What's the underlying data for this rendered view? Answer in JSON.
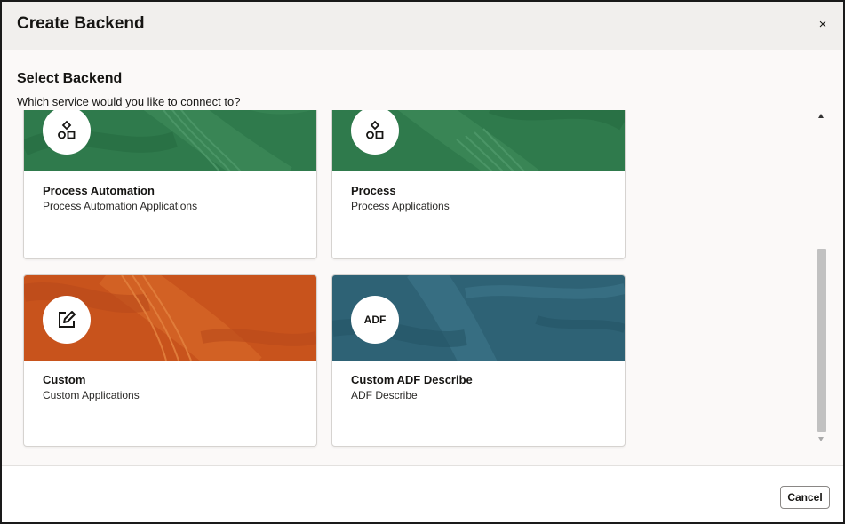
{
  "dialog": {
    "title": "Create Backend",
    "close_icon": "close-icon",
    "close_glyph": "×"
  },
  "section": {
    "title": "Select Backend",
    "subtitle": "Which service would you like to connect to?"
  },
  "cards": [
    {
      "title": "Process Automation",
      "description": "Process Automation Applications",
      "icon": "shapes-icon",
      "banner_color": "#2f7a4c"
    },
    {
      "title": "Process",
      "description": "Process Applications",
      "icon": "shapes-icon",
      "banner_color": "#2f7a4c"
    },
    {
      "title": "Custom",
      "description": "Custom Applications",
      "icon": "edit-icon",
      "banner_color": "#c8531c"
    },
    {
      "title": "Custom ADF Describe",
      "description": "ADF Describe",
      "icon": "adf-badge",
      "badge_text": "ADF",
      "banner_color": "#2e6275"
    }
  ],
  "footer": {
    "cancel_label": "Cancel"
  },
  "colors": {
    "header_bg": "#f1efed",
    "green_banner": "#2f7a4c",
    "orange_banner": "#c8531c",
    "teal_banner": "#2e6275"
  }
}
